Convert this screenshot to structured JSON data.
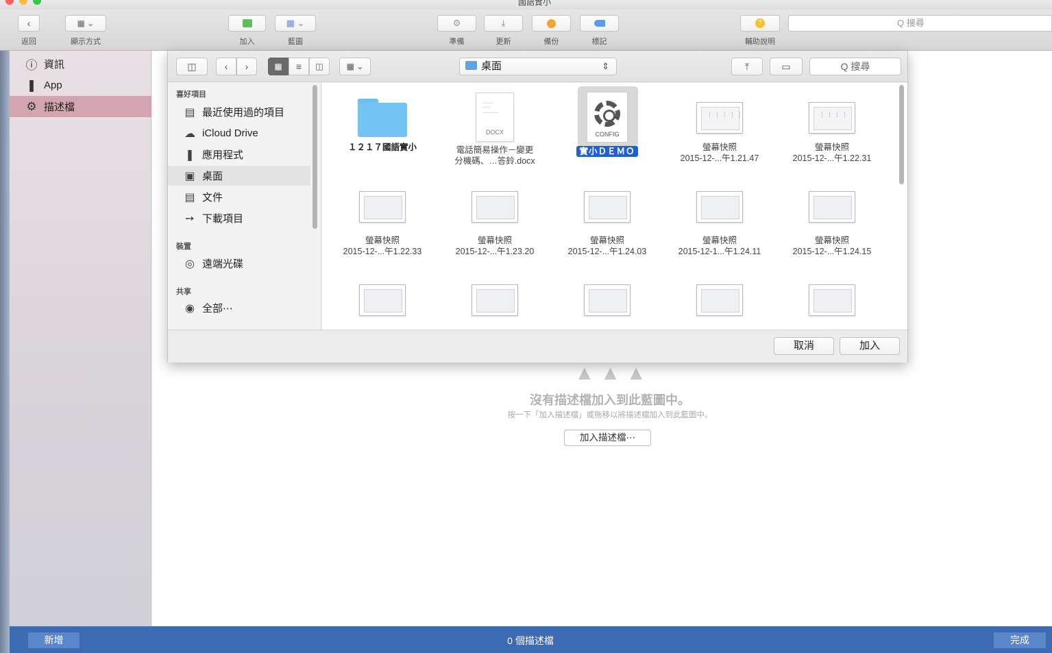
{
  "window": {
    "title": "國語實小"
  },
  "toolbar": {
    "back_label": "返回",
    "view_label": "顯示方式",
    "add_label": "加入",
    "blueprint_label": "藍圖",
    "prepare_label": "準備",
    "update_label": "更新",
    "backup_label": "備份",
    "tag_label": "標記",
    "help_label": "輔助說明",
    "search_placeholder": "Q 搜尋"
  },
  "sidebar": {
    "items": [
      {
        "label": "資訊",
        "icon": "info-icon"
      },
      {
        "label": "App",
        "icon": "app-icon"
      },
      {
        "label": "描述檔",
        "icon": "gear-icon",
        "selected": true
      }
    ]
  },
  "empty_state": {
    "title": "沒有描述檔加入到此藍圖中。",
    "subtitle": "按一下「加入描述檔」或拖移以將描述檔加入到此藍圖中。",
    "button_label": "加入描述檔⋯"
  },
  "bottom_bar": {
    "new_label": "新增",
    "count_text": "0 個描述檔",
    "done_label": "完成"
  },
  "dialog": {
    "location": "桌面",
    "search_placeholder": "Q 搜尋",
    "sidebar": {
      "favorites_header": "喜好項目",
      "favorites": [
        {
          "label": "最近使用過的項目",
          "icon": "recents-icon"
        },
        {
          "label": "iCloud Drive",
          "icon": "cloud-icon"
        },
        {
          "label": "應用程式",
          "icon": "applications-icon"
        },
        {
          "label": "桌面",
          "icon": "desktop-icon",
          "selected": true
        },
        {
          "label": "文件",
          "icon": "documents-icon"
        },
        {
          "label": "下載項目",
          "icon": "downloads-icon"
        }
      ],
      "devices_header": "裝置",
      "devices": [
        {
          "label": "遠端光碟",
          "icon": "disc-icon"
        }
      ],
      "shared_header": "共享",
      "shared": [
        {
          "label": "全部⋯",
          "icon": "network-icon"
        }
      ]
    },
    "files": [
      {
        "line1": "１２１７國語實小",
        "line2": "",
        "kind": "folder"
      },
      {
        "line1": "電話簡易操作－變更",
        "line2": "分機碼、…答鈴.docx",
        "kind": "docx",
        "badge": "DOCX"
      },
      {
        "line1": "實小ＤＥＭＯ",
        "line2": "",
        "kind": "config",
        "badge": "CONFIG",
        "selected": true
      },
      {
        "line1": "螢幕快照",
        "line2": "2015-12-...午1.21.47",
        "kind": "screenshot"
      },
      {
        "line1": "螢幕快照",
        "line2": "2015-12-...午1.22.31",
        "kind": "screenshot"
      },
      {
        "line1": "螢幕快照",
        "line2": "2015-12-...午1.22.33",
        "kind": "screenshot"
      },
      {
        "line1": "螢幕快照",
        "line2": "2015-12-...午1.23.20",
        "kind": "screenshot"
      },
      {
        "line1": "螢幕快照",
        "line2": "2015-12-...午1.24.03",
        "kind": "screenshot"
      },
      {
        "line1": "螢幕快照",
        "line2": "2015-12-1...午1.24.11",
        "kind": "screenshot"
      },
      {
        "line1": "螢幕快照",
        "line2": "2015-12-...午1.24.15",
        "kind": "screenshot"
      },
      {
        "line1": "",
        "line2": "",
        "kind": "screenshot"
      },
      {
        "line1": "",
        "line2": "",
        "kind": "screenshot"
      },
      {
        "line1": "",
        "line2": "",
        "kind": "screenshot"
      },
      {
        "line1": "",
        "line2": "",
        "kind": "screenshot"
      },
      {
        "line1": "",
        "line2": "",
        "kind": "screenshot"
      }
    ],
    "cancel_label": "取消",
    "add_label": "加入"
  },
  "colors": {
    "accent_blue": "#3d6bb3",
    "selection_pink": "#d2a5b1",
    "selection_highlight": "#1f5ed6",
    "folder_blue": "#73c4f5"
  }
}
